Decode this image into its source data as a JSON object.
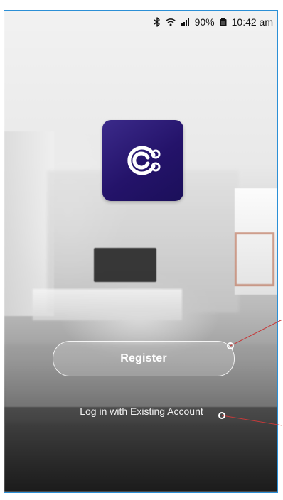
{
  "status_bar": {
    "battery": "90%",
    "time": "10:42 am",
    "icons": [
      "bluetooth-icon",
      "wifi-icon",
      "signal-icon",
      "battery-icon"
    ]
  },
  "app": {
    "logo_icon": "app-logo-icon",
    "brand_color": "#2b1878"
  },
  "actions": {
    "register_label": "Register",
    "login_label": "Log in with Existing Account"
  },
  "colors": {
    "frame_border": "#2b8fd6",
    "annotation_line": "#c53a3a"
  }
}
